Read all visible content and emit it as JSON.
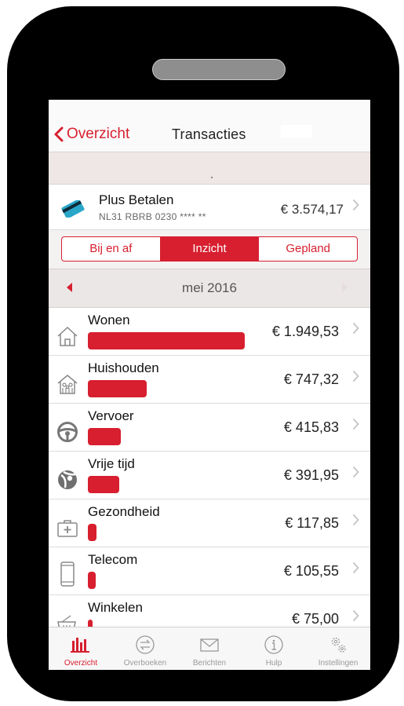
{
  "nav": {
    "back_label": "Overzicht",
    "title": "Transacties"
  },
  "account": {
    "name": "Plus Betalen",
    "iban": "NL31 RBRB 0230 **** **",
    "balance": "€ 3.574,17"
  },
  "segments": [
    "Bij en af",
    "Inzicht",
    "Gepland"
  ],
  "segment_active": "Inzicht",
  "period": {
    "label": "mei 2016"
  },
  "categories": [
    {
      "name": "Wonen",
      "amount": "€ 1.949,53",
      "icon": "house-icon"
    },
    {
      "name": "Huishouden",
      "amount": "€ 747,32",
      "icon": "household-icon"
    },
    {
      "name": "Vervoer",
      "amount": "€ 415,83",
      "icon": "steering-wheel-icon"
    },
    {
      "name": "Vrije tijd",
      "amount": "€ 391,95",
      "icon": "beach-ball-icon"
    },
    {
      "name": "Gezondheid",
      "amount": "€ 117,85",
      "icon": "first-aid-kit-icon"
    },
    {
      "name": "Telecom",
      "amount": "€ 105,55",
      "icon": "mobile-phone-icon"
    },
    {
      "name": "Winkelen",
      "amount": "€ 75,00",
      "icon": "shopping-basket-icon"
    }
  ],
  "tabbar": [
    {
      "label": "Overzicht",
      "icon": "bar-chart-icon"
    },
    {
      "label": "Overboeken",
      "icon": "transfer-icon"
    },
    {
      "label": "Berichten",
      "icon": "envelope-icon"
    },
    {
      "label": "Hulp",
      "icon": "info-icon"
    },
    {
      "label": "Instellingen",
      "icon": "gears-icon"
    }
  ],
  "colors": {
    "accent": "#d71f2f",
    "phone_frame": "#000000"
  }
}
